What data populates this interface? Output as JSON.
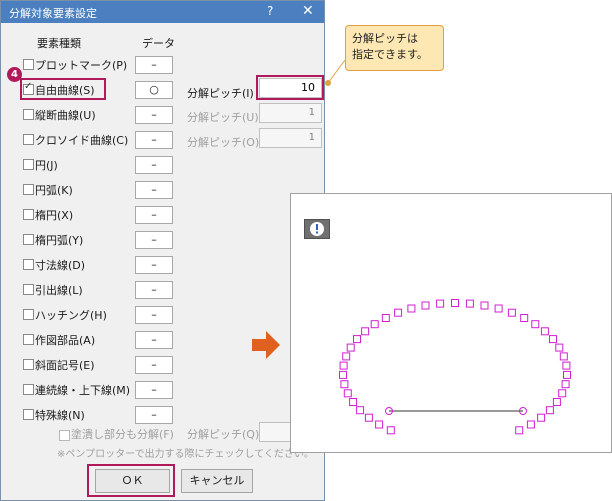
{
  "dialog": {
    "title": "分解対象要素設定",
    "help": "?",
    "close": "✕",
    "col_element_type": "要素種類",
    "col_data": "データ"
  },
  "rows": [
    {
      "label": "プロットマーク(P)",
      "checked": false,
      "data": "–"
    },
    {
      "label": "自由曲線(S)",
      "checked": true,
      "data": "○"
    },
    {
      "label": "縦断曲線(U)",
      "checked": false,
      "data": "–"
    },
    {
      "label": "クロソイド曲線(C)",
      "checked": false,
      "data": "–"
    },
    {
      "label": "円(J)",
      "checked": false,
      "data": "–"
    },
    {
      "label": "円弧(K)",
      "checked": false,
      "data": "–"
    },
    {
      "label": "楕円(X)",
      "checked": false,
      "data": "–"
    },
    {
      "label": "楕円弧(Y)",
      "checked": false,
      "data": "–"
    },
    {
      "label": "寸法線(D)",
      "checked": false,
      "data": "–"
    },
    {
      "label": "引出線(L)",
      "checked": false,
      "data": "–"
    },
    {
      "label": "ハッチング(H)",
      "checked": false,
      "data": "–"
    },
    {
      "label": "作図部品(A)",
      "checked": false,
      "data": "–"
    },
    {
      "label": "斜面記号(E)",
      "checked": false,
      "data": "–"
    },
    {
      "label": "連続線・上下線(M)",
      "checked": false,
      "data": "–"
    },
    {
      "label": "特殊線(N)",
      "checked": false,
      "data": "–"
    }
  ],
  "pitch": [
    {
      "label": "分解ピッチ(I)",
      "value": "10",
      "enabled": true
    },
    {
      "label": "分解ピッチ(U)",
      "value": "1",
      "enabled": false
    },
    {
      "label": "分解ピッチ(O)",
      "value": "1",
      "enabled": false
    }
  ],
  "special": {
    "fill_label": "塗潰し部分も分解(F)",
    "pitch_label": "分解ピッチ(Q)",
    "note": "※ペンプロッターで出力する際にチェックしてください。"
  },
  "buttons": {
    "ok": "ＯＫ",
    "cancel": "キャンセル"
  },
  "step_number": "4",
  "callout": {
    "line1": "分解ピッチは",
    "line2": "指定できます。"
  },
  "colors": {
    "highlight": "#b0195a",
    "marker": "#d020d0",
    "titlebar": "#4b7fbf",
    "arrow": "#e06020"
  }
}
